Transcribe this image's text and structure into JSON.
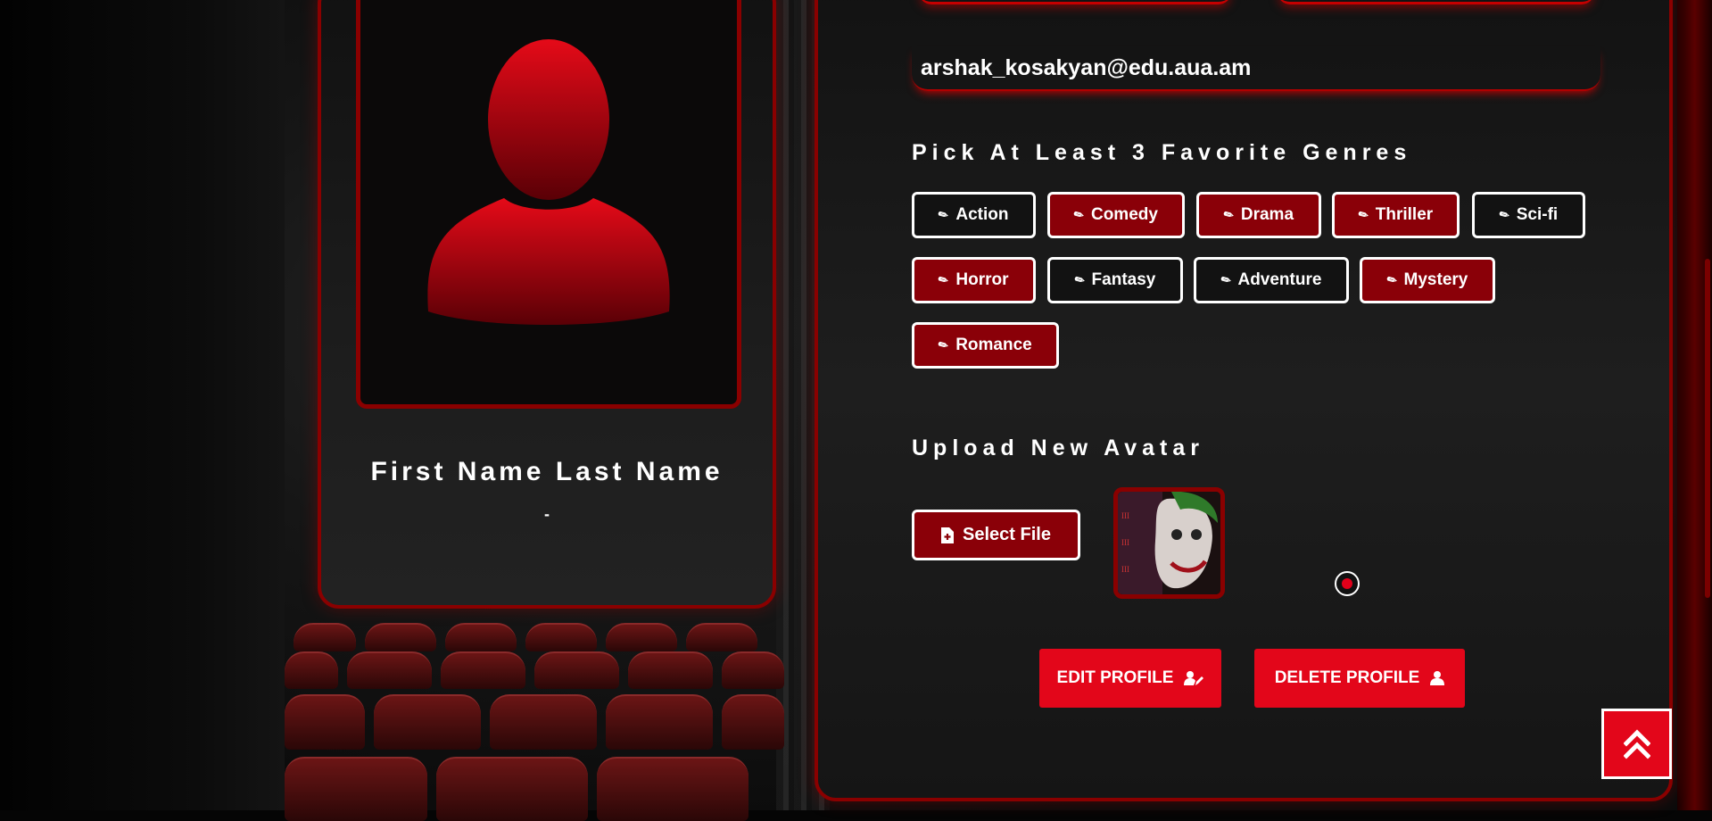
{
  "profile": {
    "full_name": "First Name Last Name",
    "subtitle": "-",
    "avatar_icon": "user-silhouette-icon"
  },
  "form": {
    "email_value": "arshak_kosakyan@edu.aua.am",
    "genres_title": "Pick At Least 3 Favorite Genres",
    "genres": [
      {
        "label": "Action",
        "selected": false
      },
      {
        "label": "Comedy",
        "selected": true
      },
      {
        "label": "Drama",
        "selected": true
      },
      {
        "label": "Thriller",
        "selected": true
      },
      {
        "label": "Sci-fi",
        "selected": false
      },
      {
        "label": "Horror",
        "selected": true
      },
      {
        "label": "Fantasy",
        "selected": false
      },
      {
        "label": "Adventure",
        "selected": false
      },
      {
        "label": "Mystery",
        "selected": true
      },
      {
        "label": "Romance",
        "selected": true
      }
    ],
    "avatar_title": "Upload New Avatar",
    "select_file_label": "Select File"
  },
  "actions": {
    "edit_label": "EDIT PROFILE",
    "delete_label": "DELETE PROFILE"
  },
  "colors": {
    "accent": "#e3061a",
    "selected_genre": "#8a0008",
    "border_red": "#8a0000"
  }
}
